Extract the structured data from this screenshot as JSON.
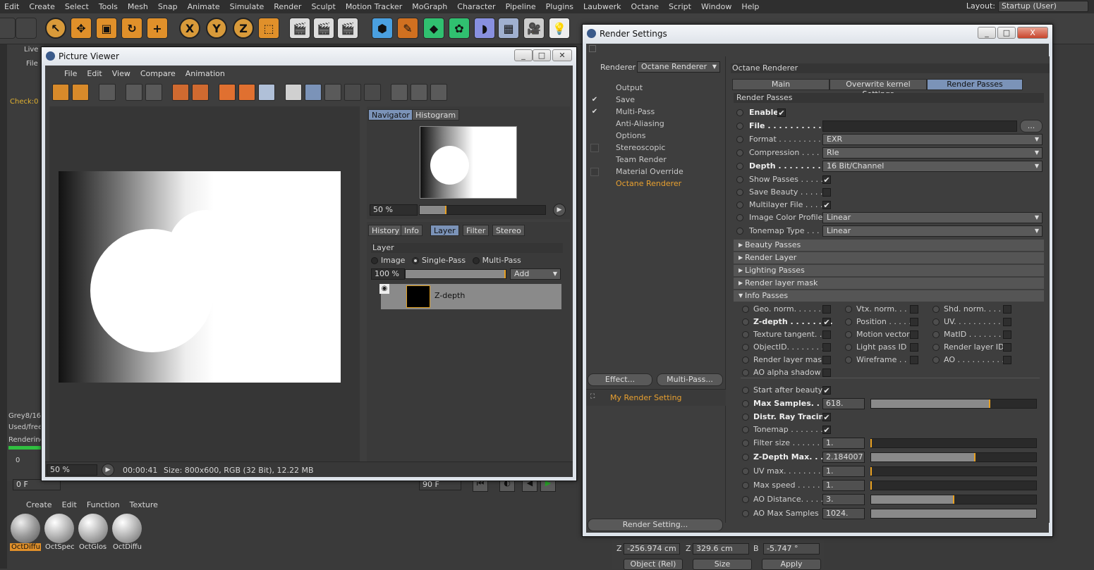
{
  "menubar": {
    "items": [
      "Edit",
      "Create",
      "Select",
      "Tools",
      "Mesh",
      "Snap",
      "Animate",
      "Simulate",
      "Render",
      "Sculpt",
      "Motion Tracker",
      "MoGraph",
      "Character",
      "Pipeline",
      "Plugins",
      "Laubwerk",
      "Octane",
      "Script",
      "Window",
      "Help"
    ],
    "layout_label": "Layout:",
    "layout_value": "Startup (User)"
  },
  "toolbar": {
    "icons": [
      "undo-icon",
      "redo-icon",
      "select-icon",
      "move-icon",
      "scale-icon",
      "rotate-icon",
      "live-select-icon",
      "x-axis-icon",
      "y-axis-icon",
      "z-axis-icon",
      "coordinate-system-icon",
      "render-view-icon",
      "render-to-picture-viewer-icon",
      "render-settings-icon",
      "cube-icon",
      "pen-icon",
      "subdivision-icon",
      "cloner-icon",
      "deformer-icon",
      "floor-icon",
      "camera-icon",
      "light-icon"
    ],
    "x_label": "X",
    "y_label": "Y",
    "z_label": "Z"
  },
  "background": {
    "live_label": "Live",
    "file_label": "File",
    "check_label": "Check:0",
    "grey_label": "Grey8/16:",
    "used_label": "Used/free",
    "rendering_label": "Rendering",
    "frame_start": "0 F",
    "frame_a": "0 F",
    "frame_b": "90 F",
    "frame_c": "90 F",
    "timeline_zero": "0"
  },
  "materials": {
    "menu": [
      "Create",
      "Edit",
      "Function",
      "Texture"
    ],
    "items": [
      "OctDiffu",
      "OctSpec",
      "OctGlos",
      "OctDiffu"
    ]
  },
  "coords": {
    "z_label": "Z",
    "z_value": "-256.974 cm",
    "z2_label": "Z",
    "z2_value": "329.6 cm",
    "b_label": "B",
    "b_value": "-5.747 °",
    "mode": "Object (Rel)",
    "size": "Size",
    "apply": "Apply"
  },
  "picture_viewer": {
    "title": "Picture Viewer",
    "menu": [
      "File",
      "Edit",
      "View",
      "Compare",
      "Animation"
    ],
    "nav_tabs": [
      "Navigator",
      "Histogram"
    ],
    "nav_zoom": "50 %",
    "nav_zoom_fraction": 0.21,
    "layer_tabs": [
      "History",
      "Info",
      "Layer",
      "Filter",
      "Stereo"
    ],
    "layer_header": "Layer",
    "layer_modes": [
      "Image",
      "Single-Pass",
      "Multi-Pass"
    ],
    "layer_opacity": "100 %",
    "layer_add": "Add",
    "layer_name": "Z-depth",
    "status_zoom": "50 %",
    "status_time": "00:00:41",
    "status_info": "Size: 800x600, RGB (32 Bit), 12.22 MB"
  },
  "render_settings": {
    "title": "Render Settings",
    "renderer_label": "Renderer",
    "renderer_value": "Octane Renderer",
    "tree": [
      {
        "label": "Output",
        "check": ""
      },
      {
        "label": "Save",
        "check": "✔"
      },
      {
        "label": "Multi-Pass",
        "check": "✔"
      },
      {
        "label": "Anti-Aliasing",
        "check": ""
      },
      {
        "label": "Options",
        "check": ""
      },
      {
        "label": "Stereoscopic",
        "check": "box"
      },
      {
        "label": "Team Render",
        "check": ""
      },
      {
        "label": "Material Override",
        "check": "box"
      },
      {
        "label": "Octane Renderer",
        "check": ""
      }
    ],
    "effect_btn": "Effect...",
    "multipass_btn": "Multi-Pass...",
    "preset_name": "My Render Setting",
    "render_setting_btn": "Render Setting...",
    "panel_title": "Octane Renderer",
    "tabs": [
      "Main",
      "Overwrite kernel Settings",
      "Render Passes"
    ],
    "section_title": "Render Passes",
    "enable_label": "Enable",
    "file_label": "File . . . . . . . . . . . . .",
    "file_btn": "...",
    "format_label": "Format . . . . . . . . . .",
    "format_value": "EXR",
    "compression_label": "Compression . . . . .",
    "compression_value": "Rle",
    "depth_label": "Depth . . . . . . . . . . .",
    "depth_value": "16 Bit/Channel",
    "show_passes_label": "Show Passes . . . . .",
    "save_beauty_label": "Save Beauty . . . . . .",
    "multilayer_label": "Multilayer File . . . .",
    "color_profile_label": "Image Color Profile",
    "color_profile_value": "Linear",
    "tonemap_type_label": "Tonemap Type . . . .",
    "tonemap_type_value": "Linear",
    "sections": [
      "Beauty Passes",
      "Render Layer",
      "Lighting Passes",
      "Render layer mask",
      "Info Passes"
    ],
    "info_passes": [
      {
        "label": "Geo. norm. . . . . . . .",
        "checked": false,
        "bold": false
      },
      {
        "label": "Vtx. norm. . . .",
        "checked": false,
        "bold": false
      },
      {
        "label": "Shd. norm. . . . .",
        "checked": false,
        "bold": false
      },
      {
        "label": "Z-depth . . . . . . . .",
        "checked": true,
        "bold": true
      },
      {
        "label": "Position . . . . .",
        "checked": false,
        "bold": false
      },
      {
        "label": "UV. . . . . . . . . . .",
        "checked": false,
        "bold": false
      },
      {
        "label": "Texture tangent. .",
        "checked": false,
        "bold": false
      },
      {
        "label": "Motion vector",
        "checked": false,
        "bold": false
      },
      {
        "label": "MatID . . . . . . . . .",
        "checked": false,
        "bold": false
      },
      {
        "label": "ObjectID. . . . . . . .",
        "checked": false,
        "bold": false
      },
      {
        "label": "Light pass ID",
        "checked": false,
        "bold": false
      },
      {
        "label": "Render layer ID",
        "checked": false,
        "bold": false
      },
      {
        "label": "Render layer mask",
        "checked": false,
        "bold": false
      },
      {
        "label": "Wireframe . . . .",
        "checked": false,
        "bold": false
      },
      {
        "label": "AO . . . . . . . . . . .",
        "checked": false,
        "bold": false
      },
      {
        "label": "AO alpha shadow",
        "checked": false,
        "bold": false
      }
    ],
    "start_after_beauty_label": "Start after beauty",
    "params": [
      {
        "label": "Max Samples. . . .",
        "value": "618.",
        "fraction": 0.72,
        "bold": true
      },
      {
        "label": "Filter size . . . . . . .",
        "value": "1.",
        "fraction": 0.0,
        "bold": false
      },
      {
        "label": "Z-Depth Max. . . . .",
        "value": "2.184007",
        "fraction": 0.63,
        "bold": true
      },
      {
        "label": "UV max. . . . . . . . .",
        "value": "1.",
        "fraction": 0.0,
        "bold": false
      },
      {
        "label": "Max speed . . . . . .",
        "value": "1.",
        "fraction": 0.0,
        "bold": false
      },
      {
        "label": "AO Distance. . . . .",
        "value": "3.",
        "fraction": 0.5,
        "bold": false
      },
      {
        "label": "AO Max Samples",
        "value": "1024.",
        "fraction": 1.0,
        "bold": false
      }
    ],
    "distr_label": "Distr. Ray Tracing",
    "tonemap_label": "Tonemap . . . . . . .",
    "window_controls": [
      "_",
      "□",
      "X"
    ]
  }
}
